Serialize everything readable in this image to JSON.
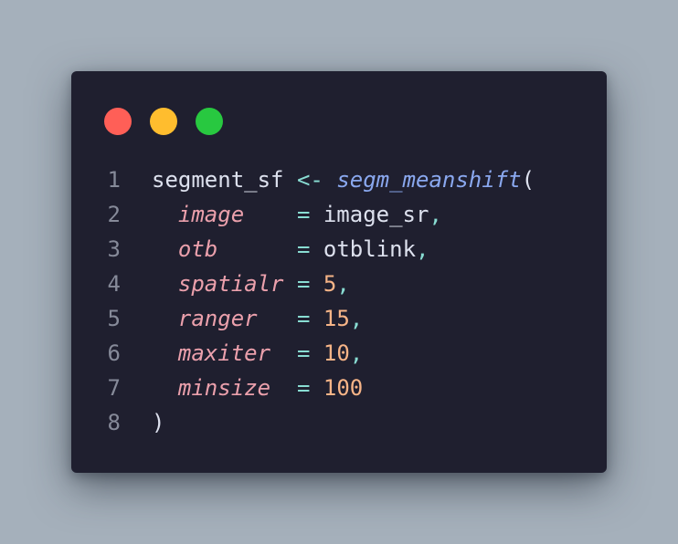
{
  "window": {
    "buttons": [
      {
        "name": "close",
        "color": "#ff5f57"
      },
      {
        "name": "minimize",
        "color": "#ffbd2e"
      },
      {
        "name": "maximize",
        "color": "#28c840"
      }
    ]
  },
  "code": {
    "lines": [
      {
        "n": "1",
        "tokens": [
          {
            "t": "segment_sf",
            "k": "ident"
          },
          {
            "t": " ",
            "k": "ws"
          },
          {
            "t": "<-",
            "k": "op"
          },
          {
            "t": " ",
            "k": "ws"
          },
          {
            "t": "segm_meanshift",
            "k": "func"
          },
          {
            "t": "(",
            "k": "ident"
          }
        ]
      },
      {
        "n": "2",
        "tokens": [
          {
            "t": "  ",
            "k": "ws"
          },
          {
            "t": "image",
            "k": "arg"
          },
          {
            "t": "    ",
            "k": "ws"
          },
          {
            "t": "=",
            "k": "op"
          },
          {
            "t": " ",
            "k": "ws"
          },
          {
            "t": "image_sr",
            "k": "ident"
          },
          {
            "t": ",",
            "k": "punct"
          }
        ]
      },
      {
        "n": "3",
        "tokens": [
          {
            "t": "  ",
            "k": "ws"
          },
          {
            "t": "otb",
            "k": "arg"
          },
          {
            "t": "      ",
            "k": "ws"
          },
          {
            "t": "=",
            "k": "op"
          },
          {
            "t": " ",
            "k": "ws"
          },
          {
            "t": "otblink",
            "k": "ident"
          },
          {
            "t": ",",
            "k": "punct"
          }
        ]
      },
      {
        "n": "4",
        "tokens": [
          {
            "t": "  ",
            "k": "ws"
          },
          {
            "t": "spatialr",
            "k": "arg"
          },
          {
            "t": " ",
            "k": "ws"
          },
          {
            "t": "=",
            "k": "op"
          },
          {
            "t": " ",
            "k": "ws"
          },
          {
            "t": "5",
            "k": "num"
          },
          {
            "t": ",",
            "k": "punct"
          }
        ]
      },
      {
        "n": "5",
        "tokens": [
          {
            "t": "  ",
            "k": "ws"
          },
          {
            "t": "ranger",
            "k": "arg"
          },
          {
            "t": "   ",
            "k": "ws"
          },
          {
            "t": "=",
            "k": "op"
          },
          {
            "t": " ",
            "k": "ws"
          },
          {
            "t": "15",
            "k": "num"
          },
          {
            "t": ",",
            "k": "punct"
          }
        ]
      },
      {
        "n": "6",
        "tokens": [
          {
            "t": "  ",
            "k": "ws"
          },
          {
            "t": "maxiter",
            "k": "arg"
          },
          {
            "t": "  ",
            "k": "ws"
          },
          {
            "t": "=",
            "k": "op"
          },
          {
            "t": " ",
            "k": "ws"
          },
          {
            "t": "10",
            "k": "num"
          },
          {
            "t": ",",
            "k": "punct"
          }
        ]
      },
      {
        "n": "7",
        "tokens": [
          {
            "t": "  ",
            "k": "ws"
          },
          {
            "t": "minsize",
            "k": "arg"
          },
          {
            "t": "  ",
            "k": "ws"
          },
          {
            "t": "=",
            "k": "op"
          },
          {
            "t": " ",
            "k": "ws"
          },
          {
            "t": "100",
            "k": "num"
          }
        ]
      },
      {
        "n": "8",
        "tokens": [
          {
            "t": ")",
            "k": "ident"
          }
        ]
      }
    ]
  }
}
